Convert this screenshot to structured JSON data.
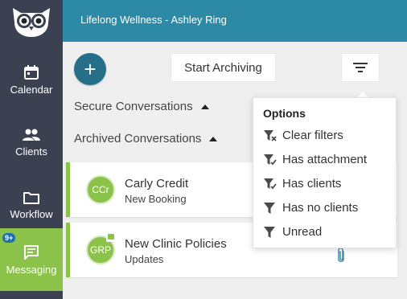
{
  "header": {
    "title": "Lifelong Wellness - Ashley Ring"
  },
  "sidebar": {
    "items": [
      {
        "label": "Calendar",
        "icon": "calendar-icon"
      },
      {
        "label": "Clients",
        "icon": "people-icon"
      },
      {
        "label": "Workflow",
        "icon": "folder-icon"
      },
      {
        "label": "Messaging",
        "icon": "message-icon",
        "badge": "9+",
        "active": true
      }
    ]
  },
  "toolbar": {
    "add_label": "+",
    "archive_label": "Start Archiving"
  },
  "sections": {
    "secure": "Secure Conversations",
    "archived": "Archived Conversations"
  },
  "conversations": [
    {
      "initials": "CCr",
      "name": "Carly Credit",
      "subtitle": "New Booking",
      "has_attachment": false
    },
    {
      "initials": "GRP",
      "name": "New Clinic Policies",
      "subtitle": "Updates",
      "has_attachment": true
    }
  ],
  "filter_menu": {
    "title": "Options",
    "items": [
      {
        "label": "Clear filters",
        "icon": "filter-clear-icon"
      },
      {
        "label": "Has attachment",
        "icon": "filter-check-icon"
      },
      {
        "label": "Has clients",
        "icon": "filter-check-icon"
      },
      {
        "label": "Has no clients",
        "icon": "filter-icon"
      },
      {
        "label": "Unread",
        "icon": "filter-icon"
      }
    ]
  },
  "colors": {
    "sidebar": "#3b4150",
    "header": "#2d8aa6",
    "accent_green": "#8bc34a",
    "add_button": "#266f89",
    "badge": "#1f6fa8"
  }
}
